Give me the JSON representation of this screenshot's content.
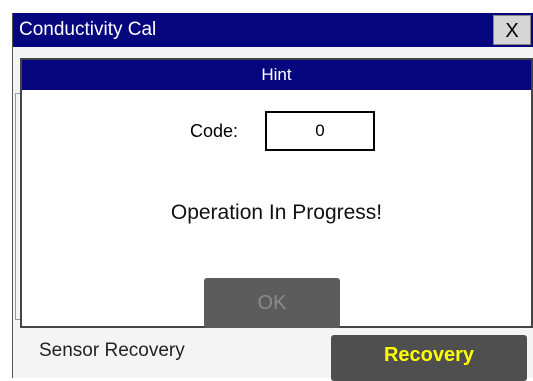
{
  "window": {
    "title": "Conductivity Cal",
    "close_label": "X"
  },
  "background": {
    "sensor_label": "Sensor Recovery",
    "recovery_button_label": "Recovery"
  },
  "dialog": {
    "title": "Hint",
    "code_label": "Code:",
    "code_value": "0",
    "message": "Operation In Progress!",
    "ok_label": "OK"
  },
  "colors": {
    "title_bar": "#06067f",
    "recovery_text": "#ffff00",
    "button_bg": "#5c5c5c"
  }
}
